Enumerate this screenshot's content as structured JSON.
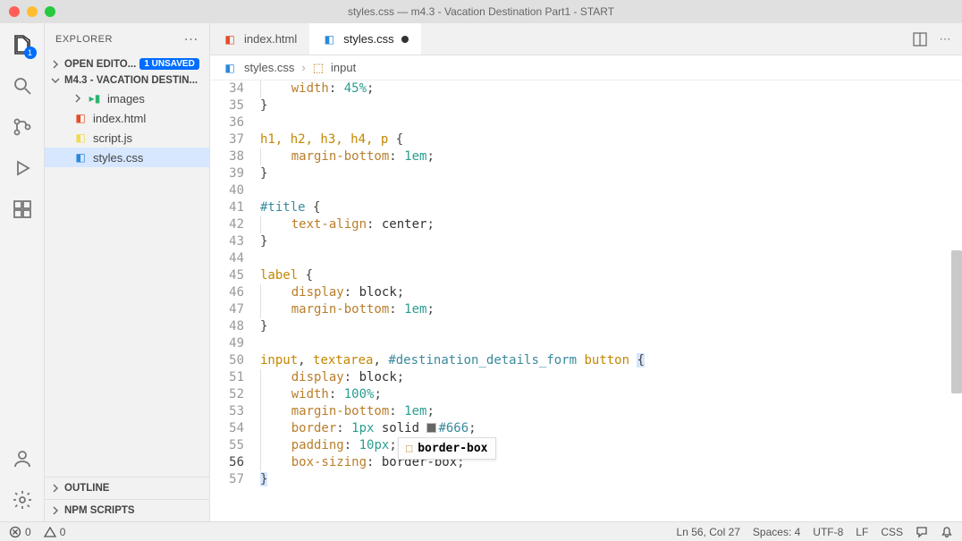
{
  "titlebar": "styles.css — m4.3 - Vacation Destination Part1 - START",
  "sidebar": {
    "title": "EXPLORER",
    "open_editors_label": "OPEN EDITO...",
    "unsaved_badge": "1 UNSAVED",
    "folder_label": "M4.3 - VACATION DESTIN...",
    "files": {
      "images": "images",
      "index_html": "index.html",
      "script_js": "script.js",
      "styles_css": "styles.css"
    },
    "outline": "OUTLINE",
    "npm_scripts": "NPM SCRIPTS"
  },
  "activitybar_badge": "1",
  "tabs": {
    "index_html": "index.html",
    "styles_css": "styles.css"
  },
  "breadcrumb": {
    "file": "styles.css",
    "symbol": "input"
  },
  "gutter": {
    "l34": "34",
    "l35": "35",
    "l36": "36",
    "l37": "37",
    "l38": "38",
    "l39": "39",
    "l40": "40",
    "l41": "41",
    "l42": "42",
    "l43": "43",
    "l44": "44",
    "l45": "45",
    "l46": "46",
    "l47": "47",
    "l48": "48",
    "l49": "49",
    "l50": "50",
    "l51": "51",
    "l52": "52",
    "l53": "53",
    "l54": "54",
    "l55": "55",
    "l56": "56",
    "l57": "57"
  },
  "code": {
    "l34_prop": "width",
    "l34_val": "45%",
    "l34_semi": ";",
    "l35": "}",
    "l37_sel": "h1, h2, h3, h4, p ",
    "l37_brace": "{",
    "l38_prop": "margin-bottom",
    "l38_val": "1em",
    "l38_semi": ";",
    "l39": "}",
    "l41_sel": "#title ",
    "l41_brace": "{",
    "l42_prop": "text-align",
    "l42_val": " center",
    "l42_semi": ";",
    "l43": "}",
    "l45_sel": "label ",
    "l45_brace": "{",
    "l46_prop": "display",
    "l46_val": " block",
    "l46_semi": ";",
    "l47_prop": "margin-bottom",
    "l47_val": "1em",
    "l47_semi": ";",
    "l48": "}",
    "l50_sel1": "input",
    "l50_comma1": ", ",
    "l50_sel2": "textarea",
    "l50_comma2": ", ",
    "l50_sel3": "#destination_details_form ",
    "l50_sel4": "button ",
    "l50_brace": "{",
    "l51_prop": "display",
    "l51_val": " block",
    "l51_semi": ";",
    "l52_prop": "width",
    "l52_val": "100%",
    "l52_semi": ";",
    "l53_prop": "margin-bottom",
    "l53_val": "1em",
    "l53_semi": ";",
    "l54_prop": "border",
    "l54_val1": "1px ",
    "l54_val2": "solid ",
    "l54_hex": "#666",
    "l54_semi": ";",
    "l55_prop": "padding",
    "l55_val": "10px",
    "l55_semi": ";",
    "l56_prop": "box-sizing",
    "l56_val": " border-box",
    "l56_semi": ";",
    "l57": "}"
  },
  "suggest": {
    "label": "border-box"
  },
  "statusbar": {
    "errors": "0",
    "warnings": "0",
    "ln_col": "Ln 56, Col 27",
    "spaces": "Spaces: 4",
    "encoding": "UTF-8",
    "eol": "LF",
    "lang": "CSS"
  }
}
